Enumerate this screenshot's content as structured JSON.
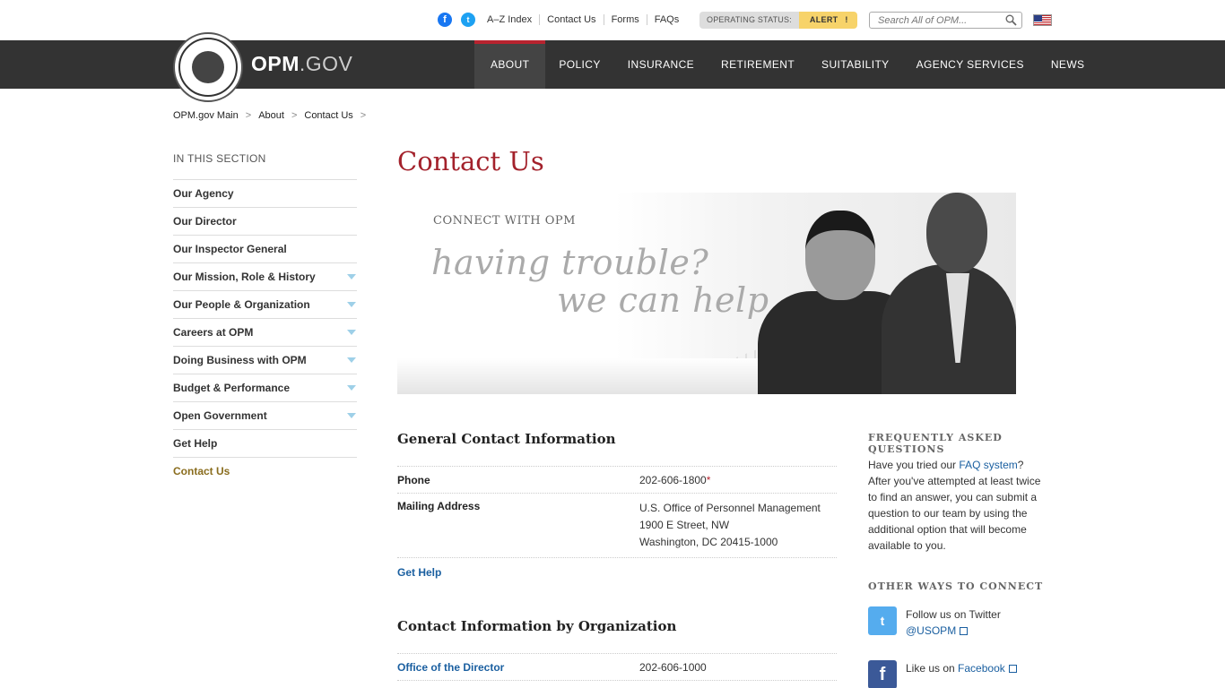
{
  "utility": {
    "links": [
      "A–Z Index",
      "Contact Us",
      "Forms",
      "FAQs"
    ],
    "status_label": "OPERATING STATUS:",
    "status_value": "ALERT",
    "status_mark": "!",
    "search_placeholder": "Search All of OPM..."
  },
  "brand": {
    "name": "OPM",
    "suffix": ".GOV"
  },
  "nav": [
    "ABOUT",
    "POLICY",
    "INSURANCE",
    "RETIREMENT",
    "SUITABILITY",
    "AGENCY SERVICES",
    "NEWS"
  ],
  "breadcrumb": [
    "OPM.gov Main",
    "About",
    "Contact Us"
  ],
  "breadcrumb_sep": ">",
  "sidebar": {
    "heading": "IN THIS SECTION",
    "items": [
      {
        "label": "Our Agency",
        "expandable": false
      },
      {
        "label": "Our Director",
        "expandable": false
      },
      {
        "label": "Our Inspector General",
        "expandable": false
      },
      {
        "label": "Our Mission, Role & History",
        "expandable": true
      },
      {
        "label": "Our People & Organization",
        "expandable": true
      },
      {
        "label": "Careers at OPM",
        "expandable": true
      },
      {
        "label": "Doing Business with OPM",
        "expandable": true
      },
      {
        "label": "Budget & Performance",
        "expandable": true
      },
      {
        "label": "Open Government",
        "expandable": true
      },
      {
        "label": "Get Help",
        "expandable": false
      },
      {
        "label": "Contact Us",
        "expandable": false
      }
    ]
  },
  "main": {
    "title": "Contact Us",
    "banner": {
      "eyebrow": "CONNECT WITH OPM",
      "line1": "having trouble?",
      "line2": "we can help"
    },
    "general": {
      "title": "General Contact Information",
      "phone_label": "Phone",
      "phone_value": "202-606-1800",
      "phone_mark": "*",
      "address_label": "Mailing Address",
      "address_lines": [
        "U.S. Office of Personnel Management",
        "1900 E Street, NW",
        "Washington, DC 20415-1000"
      ],
      "get_help": "Get Help"
    },
    "org": {
      "title": "Contact Information by Organization",
      "rows": [
        {
          "label": "Office of the Director",
          "value": "202-606-1000"
        }
      ]
    }
  },
  "rail": {
    "faq_heading": "FREQUENTLY ASKED QUESTIONS",
    "faq_pre": "Have you tried our ",
    "faq_link": "FAQ system",
    "faq_post": "? After you've attempted at least twice to find an answer, you can submit a question to our team by using the additional option that will become available to you.",
    "connect_heading": "OTHER WAYS TO CONNECT",
    "twitter_text": "Follow us on Twitter",
    "twitter_handle": "@USOPM",
    "facebook_text": "Like us on ",
    "facebook_link": "Facebook"
  },
  "colors": {
    "accent_red": "#a3212b",
    "link_blue": "#1a5fa0",
    "header_bg": "#333333",
    "alert_yellow": "#f7d36a"
  }
}
